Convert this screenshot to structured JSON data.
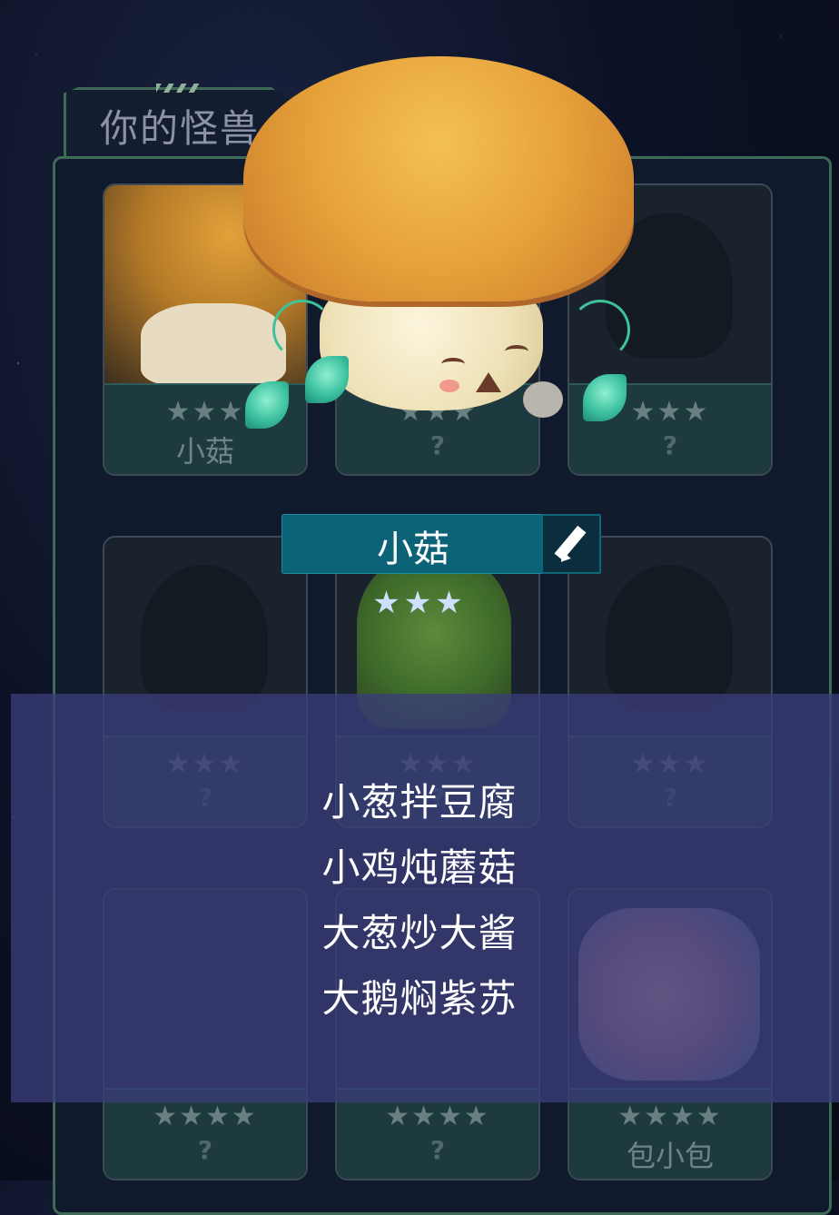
{
  "tab": {
    "title": "你的怪兽"
  },
  "cards": [
    {
      "stars": "★★★",
      "name": "小菇"
    },
    {
      "stars": "★★★",
      "name": "?"
    },
    {
      "stars": "★★★",
      "name": "?"
    },
    {
      "stars": "★★★",
      "name": "?"
    },
    {
      "stars": "★★★",
      "name": "?"
    },
    {
      "stars": "★★★",
      "name": "?"
    },
    {
      "stars": "★★★★",
      "name": "?"
    },
    {
      "stars": "★★★★",
      "name": "?"
    },
    {
      "stars": "★★★★",
      "name": "包小包"
    }
  ],
  "selected": {
    "name": "小菇",
    "stars": "★★★",
    "edit_icon": "pencil-icon"
  },
  "menu": {
    "items": [
      "小葱拌豆腐",
      "小鸡炖蘑菇",
      "大葱炒大酱",
      "大鹅焖紫苏"
    ]
  },
  "colors": {
    "accent": "#0c6378",
    "panel_border": "#3f6a58",
    "overlay": "#3a3c78"
  }
}
